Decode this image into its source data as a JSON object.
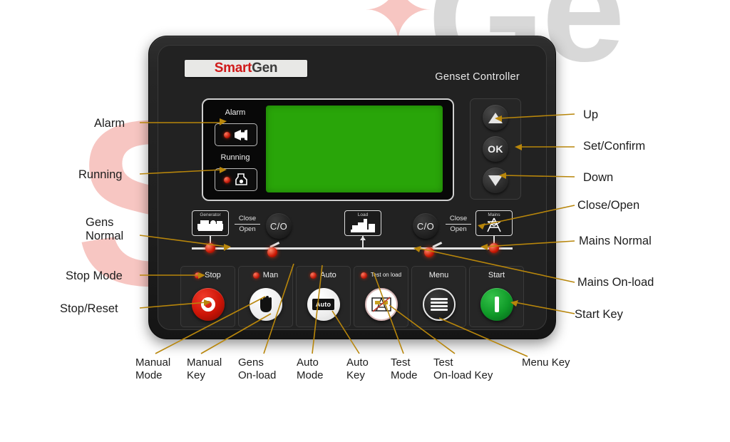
{
  "device": {
    "brand_smart": "Smart",
    "brand_gen": "Gen",
    "title": "Genset Controller",
    "accent_red": "#d01a1a",
    "lcd_color": "#29a509",
    "stop_color": "#cc1406",
    "start_color": "#109a28"
  },
  "indicators": [
    {
      "name": "alarm",
      "label": "Alarm",
      "icon": "horn-icon"
    },
    {
      "name": "running",
      "label": "Running",
      "icon": "engine-icon"
    }
  ],
  "nav_keys": [
    {
      "name": "up",
      "label": "",
      "icon": "triangle-up-icon"
    },
    {
      "name": "ok",
      "label": "OK",
      "icon": "ok-icon"
    },
    {
      "name": "down",
      "label": "",
      "icon": "triangle-down-icon"
    }
  ],
  "flow": {
    "generator_label": "Generator",
    "load_label": "Load",
    "mains_label": "Mains",
    "co_button_label": "C/O",
    "close_label": "Close",
    "open_label": "Open"
  },
  "keys": [
    {
      "name": "stop",
      "label": "Stop",
      "two_line": false,
      "led": true,
      "glyph": "stop-circle-icon"
    },
    {
      "name": "man",
      "label": "Man",
      "two_line": false,
      "led": true,
      "glyph": "hand-icon"
    },
    {
      "name": "auto",
      "label": "Auto",
      "two_line": false,
      "led": true,
      "glyph": "auto-box-icon"
    },
    {
      "name": "test",
      "label": "Test\non load",
      "two_line": true,
      "led": true,
      "glyph": "test-on-load-icon"
    },
    {
      "name": "menu",
      "label": "Menu",
      "two_line": false,
      "led": false,
      "glyph": "hamburger-icon"
    },
    {
      "name": "start",
      "label": "Start",
      "two_line": false,
      "led": false,
      "glyph": "start-bar-icon"
    }
  ],
  "annotations": {
    "left": [
      {
        "name": "alarm",
        "text": "Alarm"
      },
      {
        "name": "running",
        "text": "Running"
      },
      {
        "name": "gens-normal",
        "text": "Gens\nNormal"
      },
      {
        "name": "stop-mode",
        "text": "Stop Mode"
      },
      {
        "name": "stop-reset",
        "text": "Stop/Reset"
      }
    ],
    "right": [
      {
        "name": "up",
        "text": "Up"
      },
      {
        "name": "set-confirm",
        "text": "Set/Confirm"
      },
      {
        "name": "down",
        "text": "Down"
      },
      {
        "name": "close-open",
        "text": "Close/Open"
      },
      {
        "name": "mains-normal",
        "text": "Mains Normal"
      },
      {
        "name": "mains-on-load",
        "text": "Mains On-load"
      },
      {
        "name": "start-key",
        "text": "Start Key"
      }
    ],
    "bottom": [
      {
        "name": "manual-mode",
        "text": "Manual\nMode"
      },
      {
        "name": "manual-key",
        "text": "Manual\nKey"
      },
      {
        "name": "gens-on-load",
        "text": "Gens\nOn-load"
      },
      {
        "name": "auto-mode",
        "text": "Auto\nMode"
      },
      {
        "name": "auto-key",
        "text": "Auto\nKey"
      },
      {
        "name": "test-mode",
        "text": "Test\nMode"
      },
      {
        "name": "test-on-load-key",
        "text": "Test\nOn-load Key"
      },
      {
        "name": "menu-key",
        "text": "Menu Key"
      }
    ]
  },
  "watermark": {
    "s": "S",
    "g1": "G",
    "g2": "e",
    "star": "✦"
  }
}
